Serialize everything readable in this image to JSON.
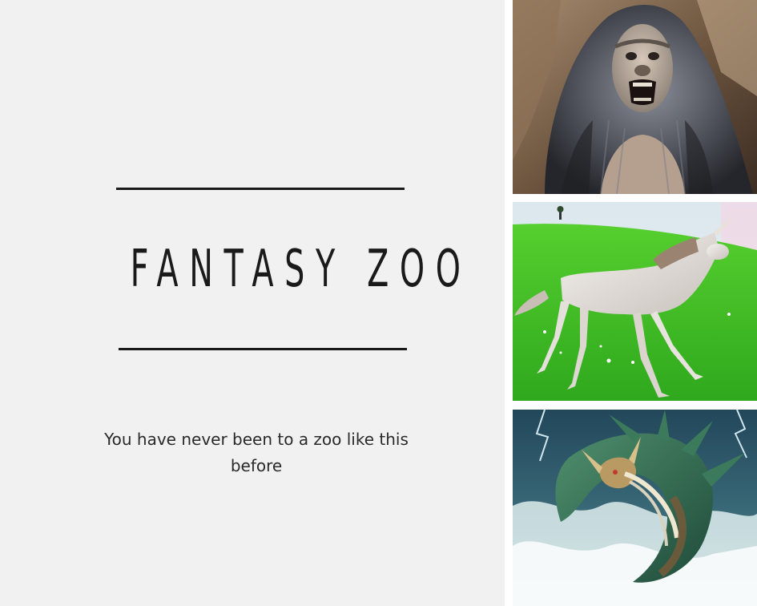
{
  "poster": {
    "title": "FANTASY ZOO",
    "tagline": "You have never been to a zoo like this before"
  },
  "photos": [
    {
      "icon": "bigfoot-photo"
    },
    {
      "icon": "unicorn-photo"
    },
    {
      "icon": "sea-dragon-photo"
    }
  ],
  "colors": {
    "background": "#f1f1f1",
    "text": "#1a1a1a",
    "grass": "#3fc22a",
    "sea": "#2f5d6b"
  }
}
